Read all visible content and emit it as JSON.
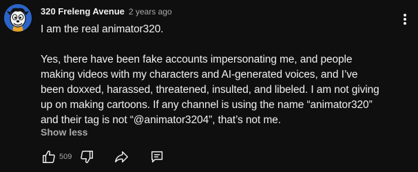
{
  "comment": {
    "author": "320 Freleng Avenue",
    "timestamp": "2 years ago",
    "paragraphs": [
      [
        "I am the real animator320."
      ],
      [
        "Yes, there have been fake accounts impersonating me, and people",
        "making videos with my characters and AI-generated voices, and I’ve",
        "been doxxed, harassed, threatened, insulted, and libeled. I am not giving",
        "up on making cartoons. If any channel is using the name “animator320”",
        "and their tag is not “@animator3204”, that’s not me."
      ]
    ],
    "show_less_label": "Show less",
    "like_count": "509"
  },
  "icons": {
    "menu": "vertical-dots-icon",
    "like": "thumbs-up-icon",
    "dislike": "thumbs-down-icon",
    "share": "share-arrow-icon",
    "reply": "reply-comment-icon"
  },
  "colors": {
    "background": "#0f0f0f",
    "text_primary": "#f1f1f1",
    "text_secondary": "#aaaaaa",
    "avatar_bg": "#2a64c8"
  }
}
